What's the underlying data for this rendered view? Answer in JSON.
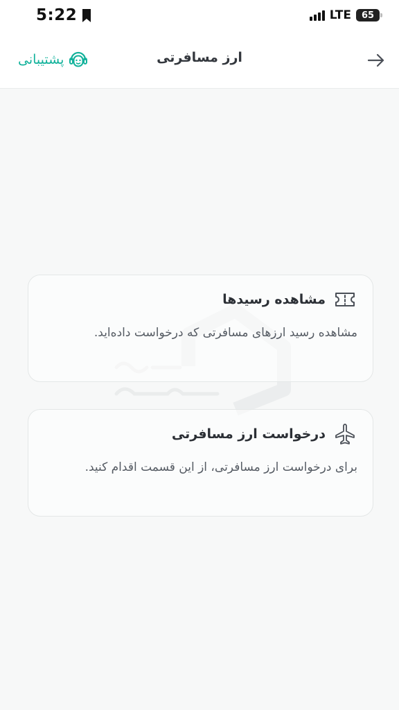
{
  "status_bar": {
    "time": "5:22",
    "network": "LTE",
    "battery": "65"
  },
  "header": {
    "title": "ارز مسافرتی",
    "support_label": "پشتیبانی"
  },
  "cards": [
    {
      "title": "مشاهده رسیدها",
      "description": "مشاهده رسید ارزهای مسافرتی که درخواست داده‌اید.",
      "icon": "ticket-icon"
    },
    {
      "title": "درخواست ارز مسافرتی",
      "description": "برای درخواست ارز مسافرتی، از این قسمت اقدام کنید.",
      "icon": "airplane-icon"
    }
  ],
  "colors": {
    "accent": "#12b29b",
    "title_text": "#33373d",
    "body_text": "#555b63",
    "background": "#f7f8f8"
  }
}
